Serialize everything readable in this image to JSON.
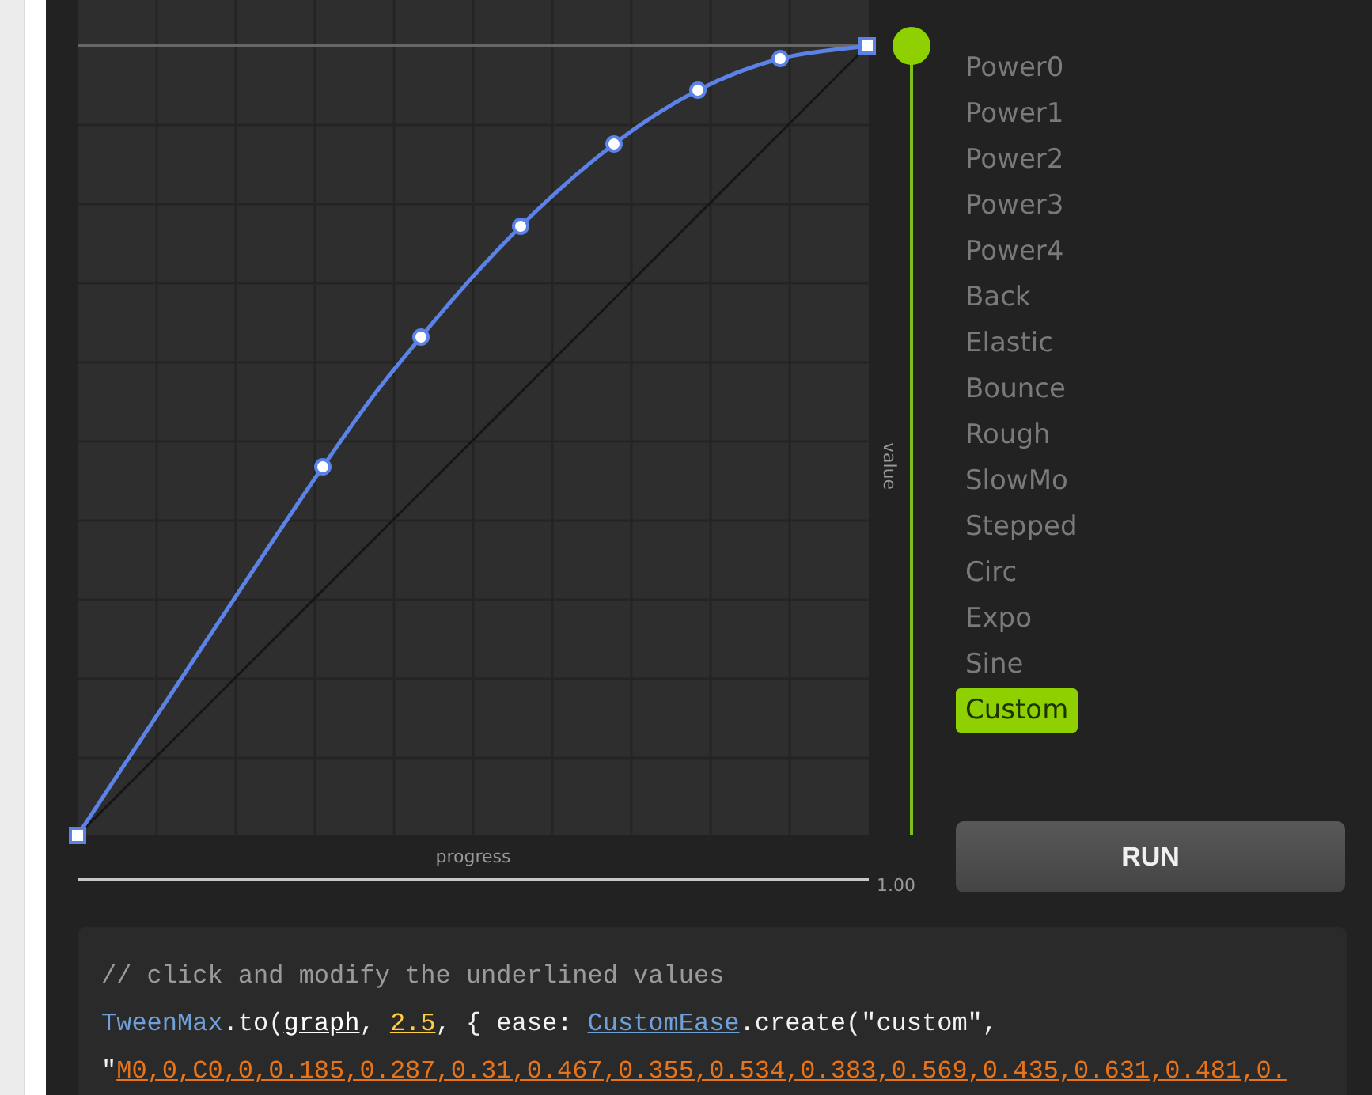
{
  "graph": {
    "x_label": "progress",
    "y_label": "value",
    "progress": {
      "level": 1,
      "reading": "1.00"
    },
    "value_slider": {
      "level": 1
    }
  },
  "eases": [
    {
      "label": "Power0",
      "selected": false
    },
    {
      "label": "Power1",
      "selected": false
    },
    {
      "label": "Power2",
      "selected": false
    },
    {
      "label": "Power3",
      "selected": false
    },
    {
      "label": "Power4",
      "selected": false
    },
    {
      "label": "Back",
      "selected": false
    },
    {
      "label": "Elastic",
      "selected": false
    },
    {
      "label": "Bounce",
      "selected": false
    },
    {
      "label": "Rough",
      "selected": false
    },
    {
      "label": "SlowMo",
      "selected": false
    },
    {
      "label": "Stepped",
      "selected": false
    },
    {
      "label": "Circ",
      "selected": false
    },
    {
      "label": "Expo",
      "selected": false
    },
    {
      "label": "Sine",
      "selected": false
    },
    {
      "label": "Custom",
      "selected": true
    }
  ],
  "run_button": {
    "label": "RUN"
  },
  "code": {
    "lines": [
      {
        "kind": "comment",
        "tokens": [
          {
            "text": "// click and modify the underlined values",
            "kind": "plain"
          }
        ]
      },
      {
        "kind": "code",
        "tokens": [
          {
            "text": "TweenMax",
            "kind": "class"
          },
          {
            "text": ".to(",
            "kind": "plain"
          },
          {
            "text": "graph",
            "kind": "target"
          },
          {
            "text": ", ",
            "kind": "plain"
          },
          {
            "text": "2.5",
            "kind": "number"
          },
          {
            "text": ", { ease: ",
            "kind": "plain"
          },
          {
            "text": "CustomEase",
            "kind": "class-link"
          },
          {
            "text": ".create(\"custom\",",
            "kind": "plain"
          }
        ]
      },
      {
        "kind": "code",
        "tokens": [
          {
            "text": "\"",
            "kind": "plain"
          },
          {
            "text": "M0,0,C0,0,0.185,0.287,0.31,0.467,0.355,0.534,0.383,0.569,0.435,0.631,0.481,0.",
            "kind": "string"
          }
        ]
      }
    ]
  }
}
